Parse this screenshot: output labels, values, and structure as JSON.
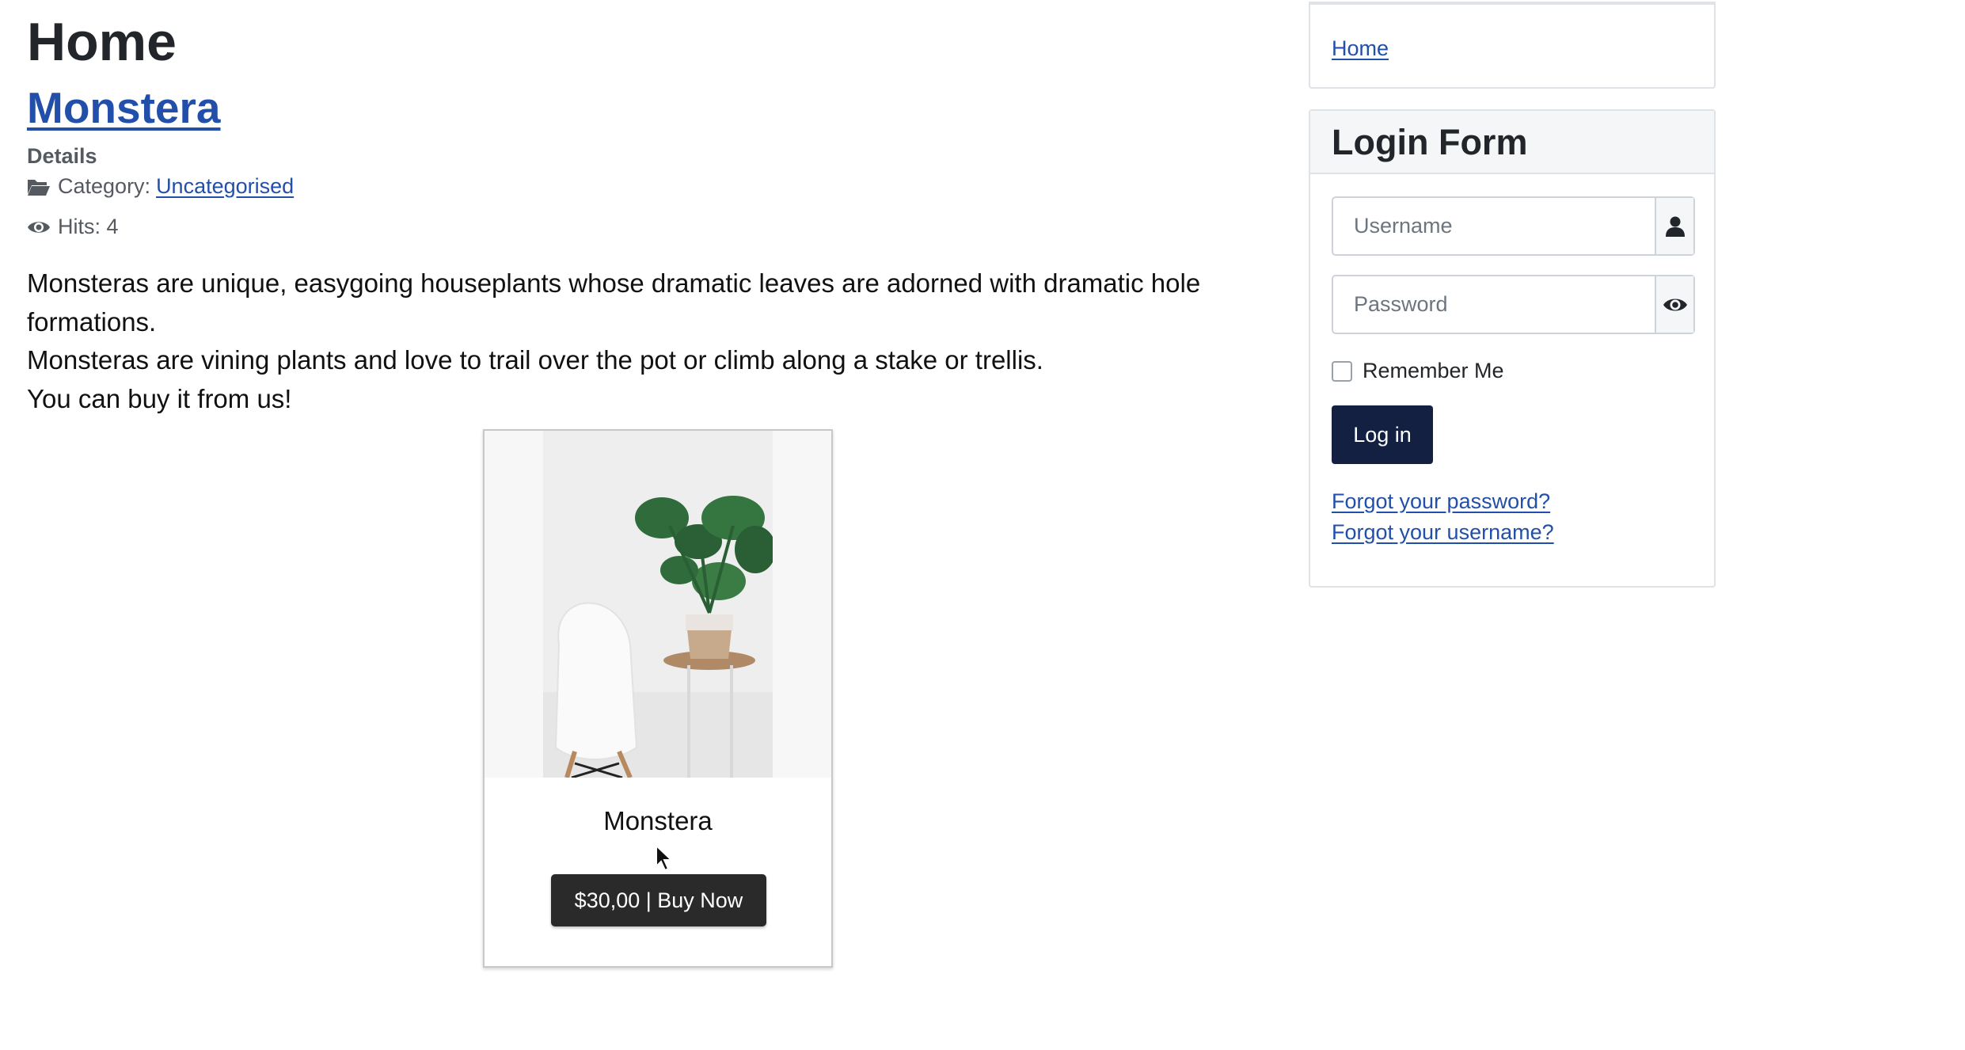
{
  "main": {
    "heading": "Home",
    "article": {
      "title": "Monstera",
      "details_label": "Details",
      "category_label": "Category:",
      "category_link": "Uncategorised",
      "hits_label": "Hits: 4",
      "paragraphs": [
        "Monsteras are unique, easygoing houseplants whose dramatic leaves are adorned with dramatic hole formations.",
        "Monsteras are vining plants and love to trail over the pot or climb along a stake or trellis.",
        "You can buy it from us!"
      ]
    },
    "product": {
      "name": "Monstera",
      "buy_label": "$30,00 | Buy Now"
    }
  },
  "sidebar": {
    "nav": {
      "home_link": "Home"
    },
    "login": {
      "title": "Login Form",
      "username_placeholder": "Username",
      "password_placeholder": "Password",
      "remember_label": "Remember Me",
      "login_button": "Log in",
      "forgot_password": "Forgot your password?",
      "forgot_username": "Forgot your username?"
    }
  },
  "icons": {
    "category": "folder-open-icon",
    "hits": "eye-icon",
    "username": "user-icon",
    "password": "eye-icon"
  },
  "colors": {
    "link": "#224faa",
    "login_button": "#132042",
    "buy_button": "#2a2a2a"
  }
}
